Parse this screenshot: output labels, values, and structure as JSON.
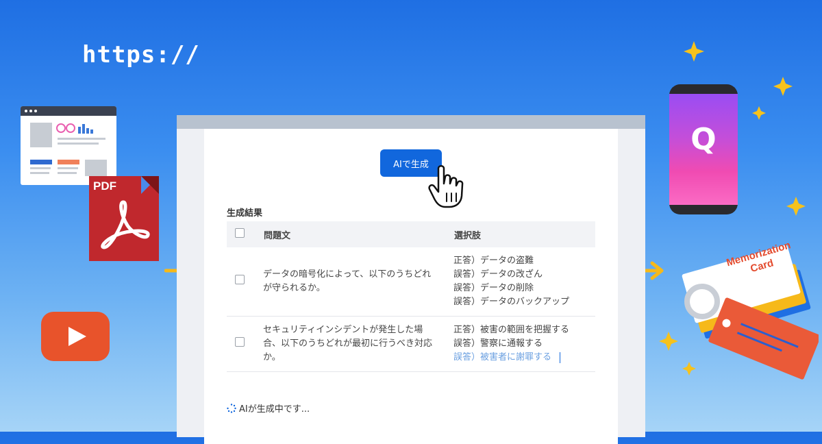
{
  "banner": {
    "url_text": "https://",
    "pdf_label": "PDF",
    "phone_letter": "Q",
    "card_title_line1": "Memorization",
    "card_title_line2": "Card"
  },
  "generator": {
    "button_label": "AIで生成",
    "result_title": "生成結果",
    "columns": [
      "問題文",
      "選択肢"
    ],
    "rows": [
      {
        "question": "データの暗号化によって、以下のうちどれが守られるか。",
        "choices": [
          "正答）データの盗難",
          "誤答）データの改ざん",
          "誤答）データの削除",
          "誤答）データのバックアップ"
        ]
      },
      {
        "question": "セキュリティインシデントが発生した場合、以下のうちどれが最初に行うべき対応か。",
        "choices": [
          "正答）被害の範囲を把握する",
          "誤答）警察に通報する",
          "誤答）被害者に謝罪する"
        ]
      }
    ],
    "status_text": "AIが生成中です..."
  },
  "colors": {
    "accent": "#1167dd",
    "arrow": "#f6b91a",
    "pdf": "#c0282d",
    "youtube": "#e8532b"
  }
}
